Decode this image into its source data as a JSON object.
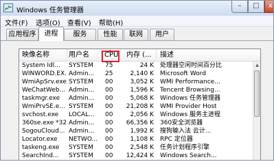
{
  "window": {
    "title": "Windows 任务管理器",
    "min_glyph": "–",
    "max_glyph": "□",
    "close_glyph": "x"
  },
  "menu": [
    "文件(F)",
    "选项(O)",
    "查看(V)",
    "帮助(H)"
  ],
  "tabs": [
    {
      "label": "应用程序",
      "active": false
    },
    {
      "label": "进程",
      "active": true
    },
    {
      "label": "服务",
      "active": false
    },
    {
      "label": "性能",
      "active": false
    },
    {
      "label": "联网",
      "active": false
    },
    {
      "label": "用户",
      "active": false
    }
  ],
  "columns": {
    "name": "映像名称",
    "user": "用户名",
    "cpu": "CPU",
    "mem": "内存 (...",
    "desc": "描述",
    "sort_glyph": "▲"
  },
  "rows": [
    {
      "name": "System Idl...",
      "user": "SYSTEM",
      "cpu": "75",
      "mem": "24 K",
      "desc": "处理器空闲时间百分比"
    },
    {
      "name": "WINWORD.EX...",
      "user": "Admin...",
      "cpu": "25",
      "mem": "2,140 K",
      "desc": "Microsoft Word"
    },
    {
      "name": "WmiApSrv.exe",
      "user": "SYSTEM",
      "cpu": "00",
      "mem": "3,052 K",
      "desc": "WMI Performance..."
    },
    {
      "name": "WeChatWeb...",
      "user": "Admin...",
      "cpu": "00",
      "mem": "1,596 K",
      "desc": "Tencent Browsing..."
    },
    {
      "name": "taskmgr.exe",
      "user": "Admin...",
      "cpu": "00",
      "mem": "5,068 K",
      "desc": "Windows 任务管理器"
    },
    {
      "name": "WmiPrvSE.e...",
      "user": "SYSTEM",
      "cpu": "00",
      "mem": "21,208 K",
      "desc": "WMI Provider Host"
    },
    {
      "name": "svchost.exe",
      "user": "LOCAL...",
      "cpu": "00",
      "mem": "2,056 K",
      "desc": "Windows 服务主进程"
    },
    {
      "name": "360se.exe *32",
      "user": "Admin...",
      "cpu": "00",
      "mem": "66,356 K",
      "desc": "360安全浏览器"
    },
    {
      "name": "SogouCloud...",
      "user": "Admin...",
      "cpu": "00",
      "mem": "1,992 K",
      "desc": "搜狗输入法 云计..."
    },
    {
      "name": "Locator.exe",
      "user": "NETWO...",
      "cpu": "00",
      "mem": "1,108 K",
      "desc": "RPC 定位器"
    },
    {
      "name": "taskeng.exe",
      "user": "SYSTEM",
      "cpu": "00",
      "mem": "2,548 K",
      "desc": "任务计划程序引擎"
    },
    {
      "name": "SearchInd...",
      "user": "SYSTEM",
      "cpu": "00",
      "mem": "12,424 K",
      "desc": "Windows Search..."
    }
  ],
  "scrollbar": {
    "up_glyph": "▲",
    "down_glyph": "▼"
  }
}
